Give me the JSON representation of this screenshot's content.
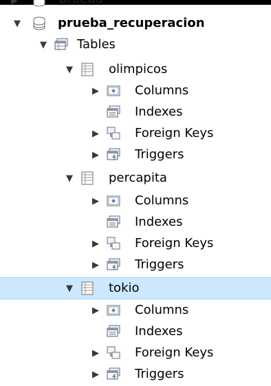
{
  "tree": {
    "partial_item": "prueba",
    "database": "prueba_recuperacion",
    "tables_folder": "Tables",
    "tables": [
      {
        "name": "olimpicos",
        "children": [
          "Columns",
          "Indexes",
          "Foreign Keys",
          "Triggers"
        ]
      },
      {
        "name": "percapita",
        "children": [
          "Columns",
          "Indexes",
          "Foreign Keys",
          "Triggers"
        ]
      },
      {
        "name": "tokio",
        "selected": true,
        "children": [
          "Columns",
          "Indexes",
          "Foreign Keys",
          "Triggers"
        ]
      }
    ]
  },
  "icons": {
    "arrow_expanded": "triangle-down",
    "arrow_collapsed": "triangle-right",
    "database": "database-icon",
    "tables_folder": "tables-folder-icon",
    "table": "table-icon",
    "columns": "columns-icon",
    "indexes": "indexes-icon",
    "foreign_keys": "foreign-keys-icon",
    "triggers": "triggers-icon"
  },
  "colors": {
    "selection": "#cce8ff",
    "selection_border": "#99d1ff"
  }
}
